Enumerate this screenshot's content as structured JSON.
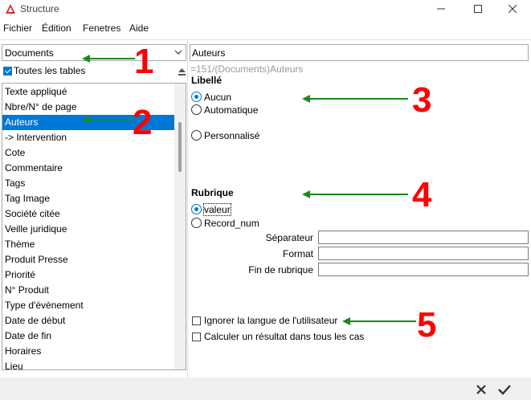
{
  "window": {
    "title": "Structure"
  },
  "menu": [
    "Fichier",
    "Édition",
    "Fenetres",
    "Aide"
  ],
  "left": {
    "table_select": "Documents",
    "all_tables_label": "Toutes les tables",
    "all_tables_checked": true,
    "fields": [
      "Texte appliqué",
      "Nbre/N° de page",
      "Auteurs",
      "-> Intervention",
      "Cote",
      "Commentaire",
      "Tags",
      "Tag Image",
      "Société citée",
      "Veille juridique",
      "Thème",
      "Produit Presse",
      "Priorité",
      "N° Produit",
      "Type d'évènement",
      "Date de début",
      "Date de fin",
      "Horaires",
      "Lieu"
    ],
    "selected_field": "Auteurs"
  },
  "right": {
    "field_name": "Auteurs",
    "formula": "=151/(Documents)Auteurs",
    "libelle": {
      "label": "Libellé",
      "options": [
        "Aucun",
        "Automatique",
        "Personnalisé"
      ],
      "selected": "Aucun"
    },
    "rubrique": {
      "label": "Rubrique",
      "options": [
        "valeur",
        "Record_num"
      ],
      "selected": "valeur",
      "separateur_label": "Séparateur",
      "format_label": "Format",
      "fin_label": "Fin de rubrique"
    },
    "ignore_lang_label": "Ignorer la langue de l'utilisateur",
    "calc_all_label": "Calculer un résultat dans tous les cas"
  },
  "annotations": [
    "1",
    "2",
    "3",
    "4",
    "5"
  ],
  "colors": {
    "accent": "#0078d7",
    "annotation_number": "#ff0000",
    "annotation_arrow": "#1a8a1a"
  }
}
